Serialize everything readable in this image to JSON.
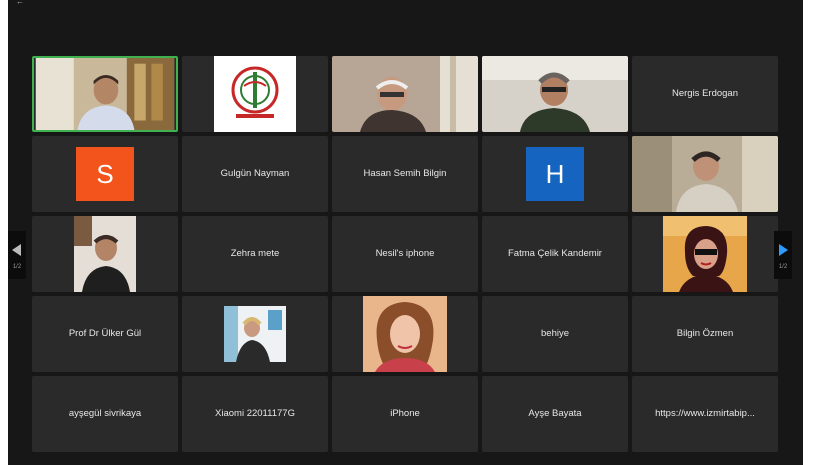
{
  "window": {
    "title": ""
  },
  "pagination": {
    "prev_label": "1/2",
    "next_label": "1/2"
  },
  "tiles": [
    {
      "name": "",
      "type": "video"
    },
    {
      "name": "",
      "type": "logo"
    },
    {
      "name": "",
      "type": "video"
    },
    {
      "name": "",
      "type": "video"
    },
    {
      "name": "Nergis Erdogan",
      "type": "name"
    },
    {
      "name": "",
      "type": "avatar",
      "initial": "S",
      "color": "#f2541c"
    },
    {
      "name": "Gulgün Nayman",
      "type": "name"
    },
    {
      "name": "Hasan Semih Bilgin",
      "type": "name"
    },
    {
      "name": "",
      "type": "avatar",
      "initial": "H",
      "color": "#1565c0"
    },
    {
      "name": "",
      "type": "video"
    },
    {
      "name": "",
      "type": "video"
    },
    {
      "name": "Zehra mete",
      "type": "name"
    },
    {
      "name": "Nesil's iphone",
      "type": "name"
    },
    {
      "name": "Fatma Çelik Kandemir",
      "type": "name"
    },
    {
      "name": "",
      "type": "video"
    },
    {
      "name": "Prof Dr Ülker Gül",
      "type": "name"
    },
    {
      "name": "",
      "type": "video"
    },
    {
      "name": "",
      "type": "video"
    },
    {
      "name": "behiye",
      "type": "name"
    },
    {
      "name": "Bilgin Özmen",
      "type": "name"
    },
    {
      "name": "ayşegül sivrikaya",
      "type": "name"
    },
    {
      "name": "Xiaomi 22011177G",
      "type": "name"
    },
    {
      "name": "iPhone",
      "type": "name"
    },
    {
      "name": "Ayşe Bayata",
      "type": "name"
    },
    {
      "name": "https://www.izmirtabip...",
      "type": "name"
    }
  ]
}
